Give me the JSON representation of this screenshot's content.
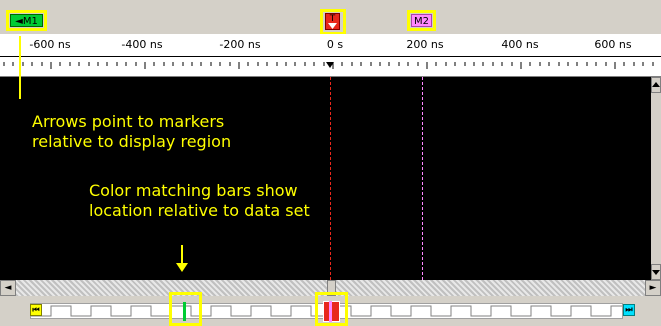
{
  "markers": {
    "m1": {
      "label": "M1",
      "glyph": "◄",
      "color": "#00cc33"
    },
    "t": {
      "label": "T",
      "color": "#e8281c"
    },
    "m2": {
      "label": "M2",
      "color": "#ff88ff"
    }
  },
  "ruler": {
    "labels": [
      "-600 ns",
      "-400 ns",
      "-200 ns",
      "0 s",
      "200 ns",
      "400 ns",
      "600 ns"
    ]
  },
  "annotations": {
    "arrows_text_line1": "Arrows point to markers",
    "arrows_text_line2": "relative to display region",
    "bars_text_line1": "Color matching bars show",
    "bars_text_line2": "location relative to data set"
  },
  "overview": {
    "left_button_glyph": "◄",
    "right_button_glyph": "►",
    "start_icon": "go-to-start-icon",
    "end_icon": "go-to-end-icon"
  },
  "colors": {
    "highlight": "#ffff00",
    "trigger": "#e8281c",
    "m1": "#00cc33",
    "m2": "#ff88ff",
    "display_bg": "#000000"
  }
}
